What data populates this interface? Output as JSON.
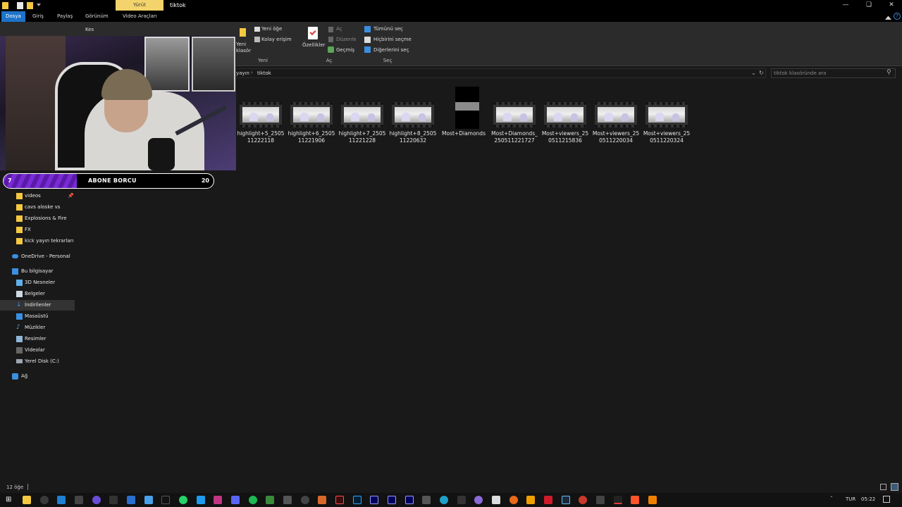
{
  "window": {
    "context_tab": "Yürüt",
    "title": "tiktok"
  },
  "tabs": [
    "Dosya",
    "Giriş",
    "Paylaş",
    "Görünüm",
    "Video Araçları"
  ],
  "ribbon": {
    "cut": "Kes",
    "new_folder": "Yeni klasör",
    "new_item": "Yeni öğe",
    "easy_access": "Kolay erişim",
    "properties": "Özellikler",
    "open": "Aç",
    "edit": "Düzenle",
    "history": "Geçmiş",
    "select_all": "Tümünü seç",
    "select_none": "Hiçbirini seçme",
    "invert_selection": "Diğerlerini seç",
    "group_new": "Yeni",
    "group_open": "Aç",
    "group_select": "Seç"
  },
  "address": {
    "parent_fragment": "yayın",
    "current": "tiktok",
    "search_placeholder": "tiktok klasöründe ara"
  },
  "files": [
    {
      "name": "highlight+5_250511222118",
      "kind": "video"
    },
    {
      "name": "highlight+6_250511221906",
      "kind": "video"
    },
    {
      "name": "highlight+7_250511221228",
      "kind": "video"
    },
    {
      "name": "highlight+8_250511220632",
      "kind": "video"
    },
    {
      "name": "Most+Diamonds",
      "kind": "vertical"
    },
    {
      "name": "Most+Diamonds_250511221727",
      "kind": "video"
    },
    {
      "name": "Most+viewers_250511215836",
      "kind": "video"
    },
    {
      "name": "Most+viewers_250511220034",
      "kind": "video"
    },
    {
      "name": "Most+viewers_250511220324",
      "kind": "video"
    }
  ],
  "nav": {
    "quick_access": [
      {
        "label": "videos",
        "pinned": true
      },
      {
        "label": "cavs aloske vs",
        "pinned": false
      },
      {
        "label": "Explosions & Fire",
        "pinned": false
      },
      {
        "label": "FX",
        "pinned": false
      },
      {
        "label": "kick yayın tekrarları",
        "pinned": false
      }
    ],
    "onedrive": "OneDrive - Personal",
    "this_pc": "Bu bilgisayar",
    "pc_items": [
      "3D Nesneler",
      "Belgeler",
      "İndirilenler",
      "Masaüstü",
      "Müzikler",
      "Resimler",
      "Videolar",
      "Yerel Disk (C:)"
    ],
    "network": "Ağ"
  },
  "status": {
    "item_count": "12 öğe"
  },
  "overlay": {
    "left_count": "7",
    "title": "ABONE BORCU",
    "right_count": "20",
    "progress": 0.35
  },
  "taskbar": {
    "language": "TUR",
    "time": "05:22"
  },
  "colors": {
    "accent": "#1d73c9",
    "context_tab": "#f3d36b",
    "overlay_purple": "#7a2bd6",
    "folder": "#f5c842"
  }
}
